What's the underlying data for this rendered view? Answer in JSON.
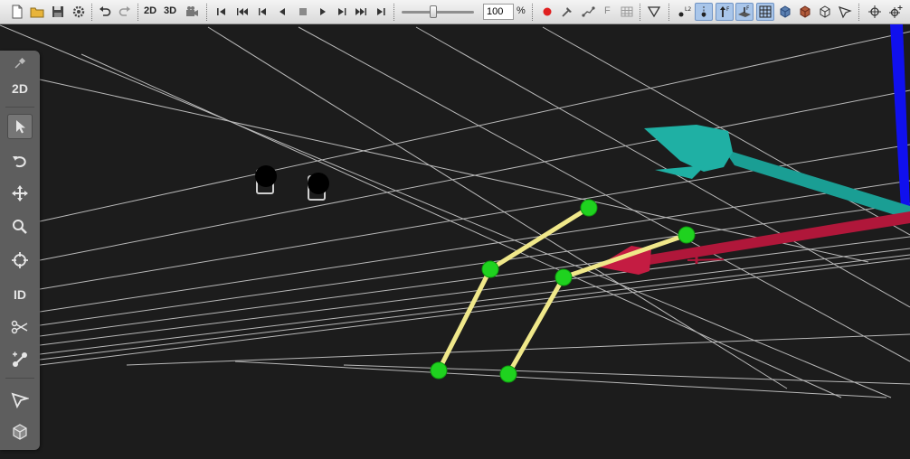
{
  "toolbar": {
    "view_2d_label": "2D",
    "view_3d_label": "3D",
    "speed_value": "100",
    "speed_unit": "%",
    "speed_fraction": 0.44,
    "force_label": "F",
    "record_color": "#e02020"
  },
  "sidebar": {
    "view_2d_label": "2D",
    "id_label": "ID"
  },
  "scene": {
    "axis_colors": {
      "x": "#b0173a",
      "y": "#1fb0a4",
      "z": "#1010ee"
    },
    "marker_color": "#1fd21f",
    "segment_color": "#f0e88a",
    "camera_color": "#000000"
  }
}
